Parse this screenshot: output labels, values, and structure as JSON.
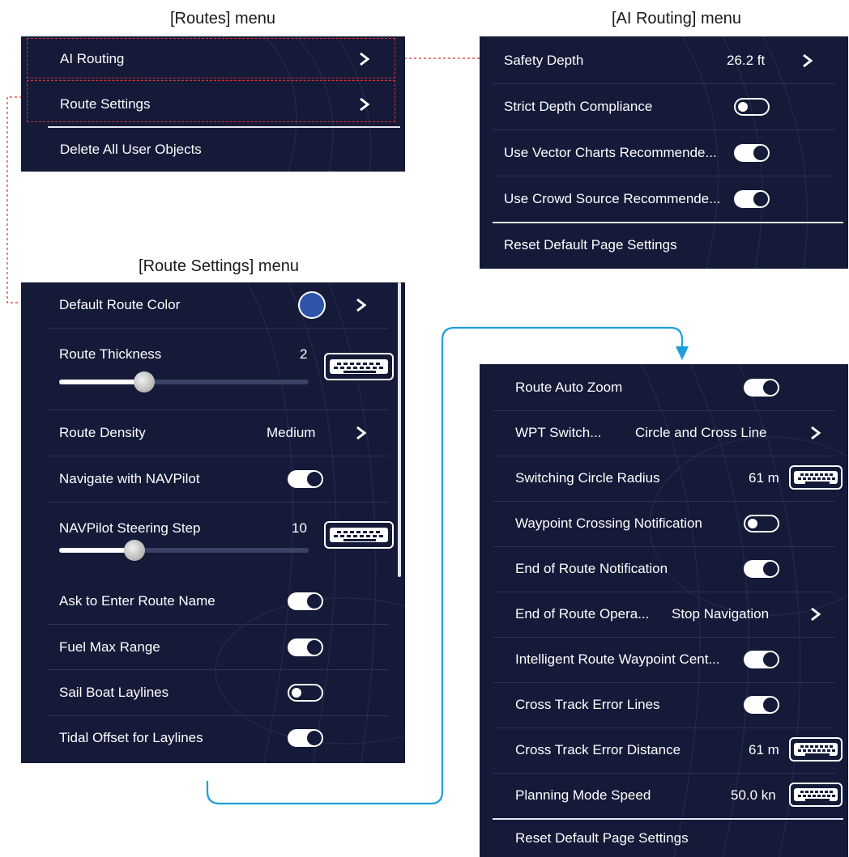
{
  "captions": {
    "routes_menu": "[Routes] menu",
    "ai_routing_menu": "[AI Routing] menu",
    "route_settings_menu": "[Route Settings] menu"
  },
  "routes_menu": {
    "items": [
      {
        "label": "AI Routing"
      },
      {
        "label": "Route Settings"
      },
      {
        "label": "Delete All User Objects"
      }
    ]
  },
  "ai_routing_menu": {
    "items": [
      {
        "label": "Safety Depth",
        "value": "26.2 ft"
      },
      {
        "label": "Strict Depth Compliance",
        "toggle": "off"
      },
      {
        "label": "Use Vector Charts Recommende...",
        "toggle": "on"
      },
      {
        "label": "Use Crowd Source Recommende...",
        "toggle": "on"
      },
      {
        "label": "Reset Default Page Settings"
      }
    ]
  },
  "route_settings_menu": {
    "items": [
      {
        "label": "Default Route Color",
        "color": "#2f55a8"
      },
      {
        "label": "Route Thickness",
        "value": "2",
        "slider_fraction": 0.3
      },
      {
        "label": "Route Density",
        "value": "Medium"
      },
      {
        "label": "Navigate with NAVPilot",
        "toggle": "on"
      },
      {
        "label": "NAVPilot Steering Step",
        "value": "10",
        "slider_fraction": 0.25
      },
      {
        "label": "Ask to Enter Route Name",
        "toggle": "on"
      },
      {
        "label": "Fuel Max Range",
        "toggle": "on"
      },
      {
        "label": "Sail Boat Laylines",
        "toggle": "off"
      },
      {
        "label": "Tidal Offset for Laylines",
        "toggle": "on"
      }
    ]
  },
  "route_settings_cont": {
    "items": [
      {
        "label": "Route Auto Zoom",
        "toggle": "on"
      },
      {
        "label": "WPT Switch...",
        "value": "Circle and Cross Line"
      },
      {
        "label": "Switching Circle Radius",
        "value": "61 m"
      },
      {
        "label": "Waypoint Crossing Notification",
        "toggle": "off"
      },
      {
        "label": "End of Route Notification",
        "toggle": "on"
      },
      {
        "label": "End of Route Opera...",
        "value": "Stop Navigation"
      },
      {
        "label": "Intelligent Route Waypoint Cent...",
        "toggle": "on"
      },
      {
        "label": "Cross Track Error Lines",
        "toggle": "on"
      },
      {
        "label": "Cross Track Error Distance",
        "value": "61 m"
      },
      {
        "label": "Planning Mode Speed",
        "value": "50.0 kn"
      },
      {
        "label": "Reset Default Page Settings"
      }
    ]
  },
  "colors": {
    "panel_bg": "#141a38",
    "dashed_highlight": "#e03030",
    "flow_arrow": "#1e9fdc",
    "route_color": "#2f55a8"
  }
}
